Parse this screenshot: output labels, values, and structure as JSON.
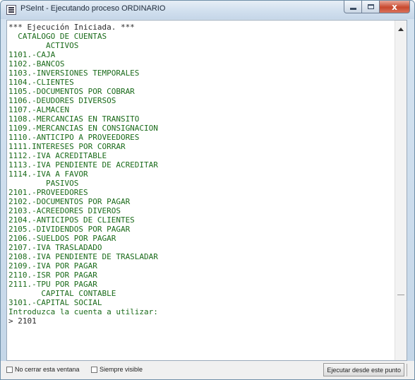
{
  "window": {
    "title": "PSeInt - Ejecutando proceso ORDINARIO",
    "close_glyph": "x"
  },
  "console": {
    "lines": [
      {
        "text": "*** Ejecución Iniciada. ***",
        "kind": "sys"
      },
      {
        "text": "  CATALOGO DE CUENTAS",
        "kind": "out"
      },
      {
        "text": "        ACTIVOS",
        "kind": "out"
      },
      {
        "text": "1101.-CAJA",
        "kind": "out"
      },
      {
        "text": "1102.-BANCOS",
        "kind": "out"
      },
      {
        "text": "1103.-INVERSIONES TEMPORALES",
        "kind": "out"
      },
      {
        "text": "1104.-CLIENTES",
        "kind": "out"
      },
      {
        "text": "1105.-DOCUMENTOS POR COBRAR",
        "kind": "out"
      },
      {
        "text": "1106.-DEUDORES DIVERSOS",
        "kind": "out"
      },
      {
        "text": "1107.-ALMACEN",
        "kind": "out"
      },
      {
        "text": "1108.-MERCANCIAS EN TRANSITO",
        "kind": "out"
      },
      {
        "text": "1109.-MERCANCIAS EN CONSIGNACION",
        "kind": "out"
      },
      {
        "text": "1110.-ANTICIPO A PROVEEDORES",
        "kind": "out"
      },
      {
        "text": "1111.INTERESES POR CORRAR",
        "kind": "out"
      },
      {
        "text": "1112.-IVA ACREDITABLE",
        "kind": "out"
      },
      {
        "text": "1113.-IVA PENDIENTE DE ACREDITAR",
        "kind": "out"
      },
      {
        "text": "1114.-IVA A FAVOR",
        "kind": "out"
      },
      {
        "text": "        PASIVOS",
        "kind": "out"
      },
      {
        "text": "2101.-PROVEEDORES",
        "kind": "out"
      },
      {
        "text": "2102.-DOCUMENTOS POR PAGAR",
        "kind": "out"
      },
      {
        "text": "2103.-ACREEDORES DIVEROS",
        "kind": "out"
      },
      {
        "text": "2104.-ANTICIPOS DE CLIENTES",
        "kind": "out"
      },
      {
        "text": "2105.-DIVIDENDOS POR PAGAR",
        "kind": "out"
      },
      {
        "text": "2106.-SUELDOS POR PAGAR",
        "kind": "out"
      },
      {
        "text": "2107.-IVA TRASLADADO",
        "kind": "out"
      },
      {
        "text": "2108.-IVA PENDIENTE DE TRASLADAR",
        "kind": "out"
      },
      {
        "text": "2109.-IVA POR PAGAR",
        "kind": "out"
      },
      {
        "text": "2110.-ISR POR PAGAR",
        "kind": "out"
      },
      {
        "text": "2111.-TPU POR PAGAR",
        "kind": "out"
      },
      {
        "text": "       CAPITAL CONTABLE",
        "kind": "out"
      },
      {
        "text": "3101.-CAPITAL SOCIAL",
        "kind": "out"
      },
      {
        "text": "Introduzca la cuenta a utilizar:",
        "kind": "out"
      },
      {
        "text": "> 2101",
        "kind": "in"
      }
    ]
  },
  "bottom": {
    "keep_open_label": "No cerrar esta ventana",
    "always_visible_label": "Siempre visible",
    "run_from_here_label": "Ejecutar desde este punto"
  },
  "colors": {
    "output_text": "#1b6b1b",
    "input_text": "#2a2a2a",
    "close_button": "#c8482e"
  }
}
